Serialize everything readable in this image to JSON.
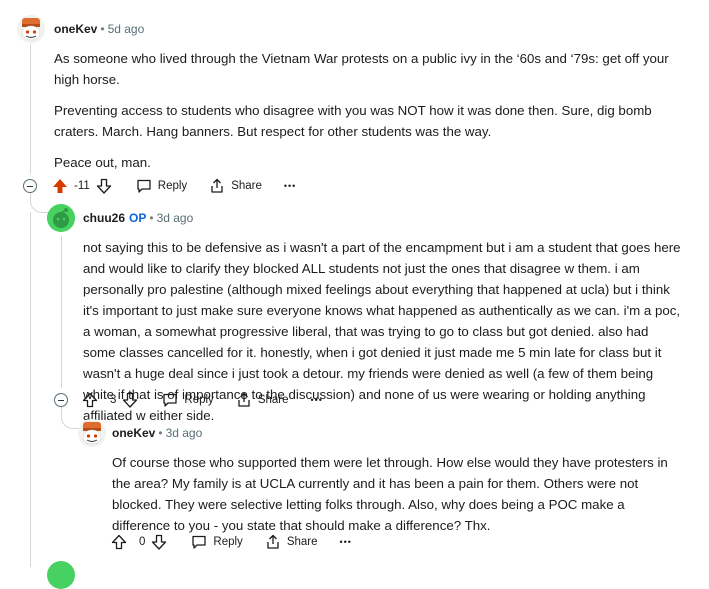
{
  "comments": [
    {
      "author": "oneKev",
      "time": "5d ago",
      "paragraphs": [
        "As someone who lived through the Vietnam War protests on a public ivy in the ‘60s and ‘79s: get off your high horse.",
        "Preventing access to students who disagree with you was NOT how it was done then. Sure, dig bomb craters. March. Hang banners. But respect for other students was the way.",
        "Peace out, man."
      ],
      "score": "-11",
      "reply_label": "Reply",
      "share_label": "Share",
      "more_label": "•••"
    },
    {
      "author": "chuu26",
      "badge": "OP",
      "time": "3d ago",
      "paragraphs": [
        "not saying this to be defensive as i wasn't a part of the encampment but i am a student that goes here and would like to clarify they blocked ALL students not just the ones that disagree w them. i am personally pro palestine (although mixed feelings about everything that happened at ucla) but i think it's important to just make sure everyone knows what happened as authentically as we can. i'm a poc, a woman, a somewhat progressive liberal, that was trying to go to class but got denied. also had some classes cancelled for it. honestly, when i got denied it just made me 5 min late for class but it wasn't a huge deal since i just took a detour. my friends were denied as well (a few of them being white if that is of importance to the discussion) and none of us were wearing or holding anything affiliated w either side."
      ],
      "score": "3",
      "reply_label": "Reply",
      "share_label": "Share",
      "more_label": "•••"
    },
    {
      "author": "oneKev",
      "time": "3d ago",
      "paragraphs": [
        "Of course those who supported them were let through. How else would they have protesters in the area? My family is at UCLA currently and it has been a pain for them. Others were not blocked. They were selective letting folks through. Also, why does being a POC make a difference to you - you state that should make a difference? Thx."
      ],
      "score": "0",
      "reply_label": "Reply",
      "share_label": "Share",
      "more_label": "•••"
    }
  ],
  "colors": {
    "upvoted": "#d93a00",
    "op_badge": "#0a66d8",
    "thread_line": "#d4d7d9",
    "avatar_green": "#46d160"
  }
}
